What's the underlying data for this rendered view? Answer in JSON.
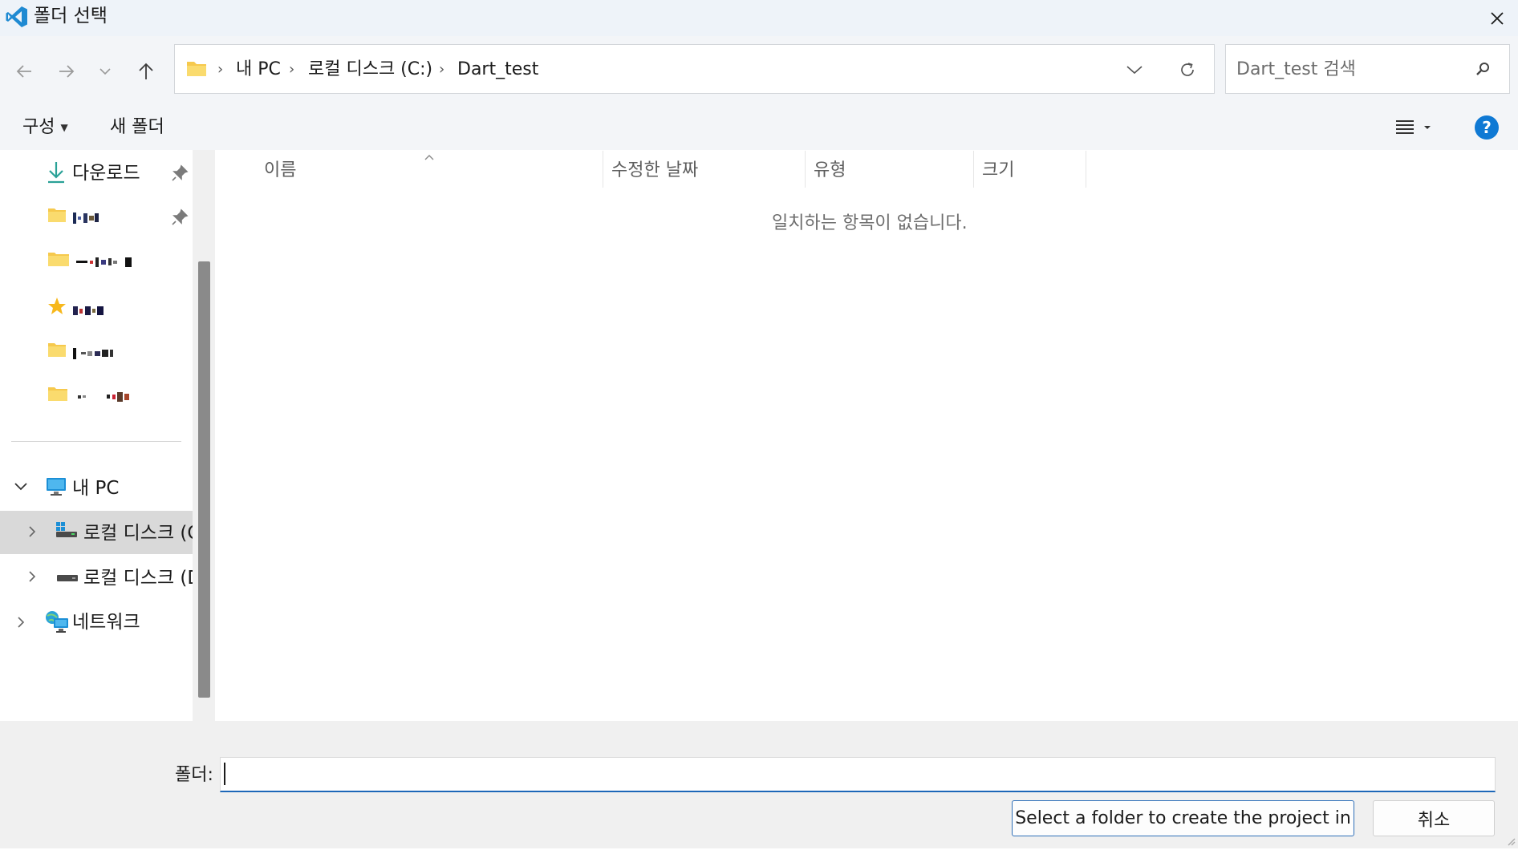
{
  "window": {
    "title": "폴더 선택"
  },
  "nav": {
    "breadcrumb": [
      "내 PC",
      "로컬 디스크 (C:)",
      "Dart_test"
    ],
    "search_placeholder": "Dart_test 검색"
  },
  "command_bar": {
    "organize": "구성",
    "new_folder": "새 폴더"
  },
  "sidebar": {
    "quick_access": [
      {
        "label": "다운로드",
        "icon": "download-icon",
        "pinned": true
      },
      {
        "label": "",
        "icon": "folder-icon",
        "pinned": true
      },
      {
        "label": "",
        "icon": "folder-icon",
        "pinned": false
      },
      {
        "label": "",
        "icon": "star-icon",
        "pinned": false
      },
      {
        "label": "",
        "icon": "folder-icon",
        "pinned": false
      },
      {
        "label": "",
        "icon": "folder-icon",
        "pinned": false
      }
    ],
    "this_pc": "내 PC",
    "drive_c": "로컬 디스크 (C",
    "drive_d": "로컬 디스크 (D",
    "network": "네트워크"
  },
  "columns": {
    "name": "이름",
    "modified": "수정한 날짜",
    "type": "유형",
    "size": "크기"
  },
  "content": {
    "empty_message": "일치하는 항목이 없습니다."
  },
  "footer": {
    "folder_label": "폴더:",
    "folder_value": "",
    "select_button": "Select a folder to create the project in",
    "cancel_button": "취소"
  },
  "colors": {
    "accent": "#1d67b8",
    "help": "#0f79d4",
    "folder": "#f6c94d",
    "selected_row": "#d9d9d9"
  }
}
